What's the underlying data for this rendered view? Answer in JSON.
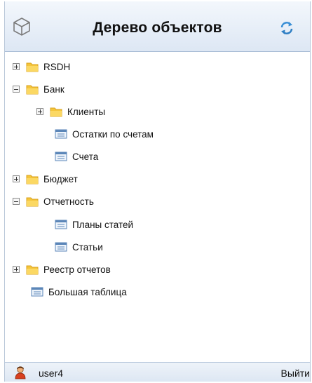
{
  "header": {
    "title": "Дерево объектов",
    "logo_icon": "cube-icon",
    "refresh_icon": "refresh-icon"
  },
  "tree": [
    {
      "label": "RSDH",
      "type": "folder",
      "toggle": "expand",
      "level": 0
    },
    {
      "label": "Банк",
      "type": "folder",
      "toggle": "collapse",
      "level": 0
    },
    {
      "label": "Клиенты",
      "type": "folder",
      "toggle": "expand",
      "level": 1
    },
    {
      "label": "Остатки по счетам",
      "type": "table",
      "level": 1
    },
    {
      "label": "Счета",
      "type": "table",
      "level": 1
    },
    {
      "label": "Бюджет",
      "type": "folder",
      "toggle": "expand",
      "level": 0
    },
    {
      "label": "Отчетность",
      "type": "folder",
      "toggle": "collapse",
      "level": 0
    },
    {
      "label": "Планы статей",
      "type": "table",
      "level": 1
    },
    {
      "label": "Статьи",
      "type": "table",
      "level": 1
    },
    {
      "label": "Реестр отчетов",
      "type": "folder",
      "toggle": "expand",
      "level": 0
    },
    {
      "label": "Большая таблица",
      "type": "table",
      "level": 0
    }
  ],
  "footer": {
    "user": "user4",
    "logout_label": "Выйти",
    "user_icon": "user-icon"
  },
  "colors": {
    "folder": "#f5c53b",
    "header_gradient_top": "#f3f7fc",
    "header_gradient_bottom": "#dde7f4",
    "footer_gradient_top": "#eef3f9",
    "footer_gradient_bottom": "#dde7f3",
    "border": "#b9c7d9"
  }
}
